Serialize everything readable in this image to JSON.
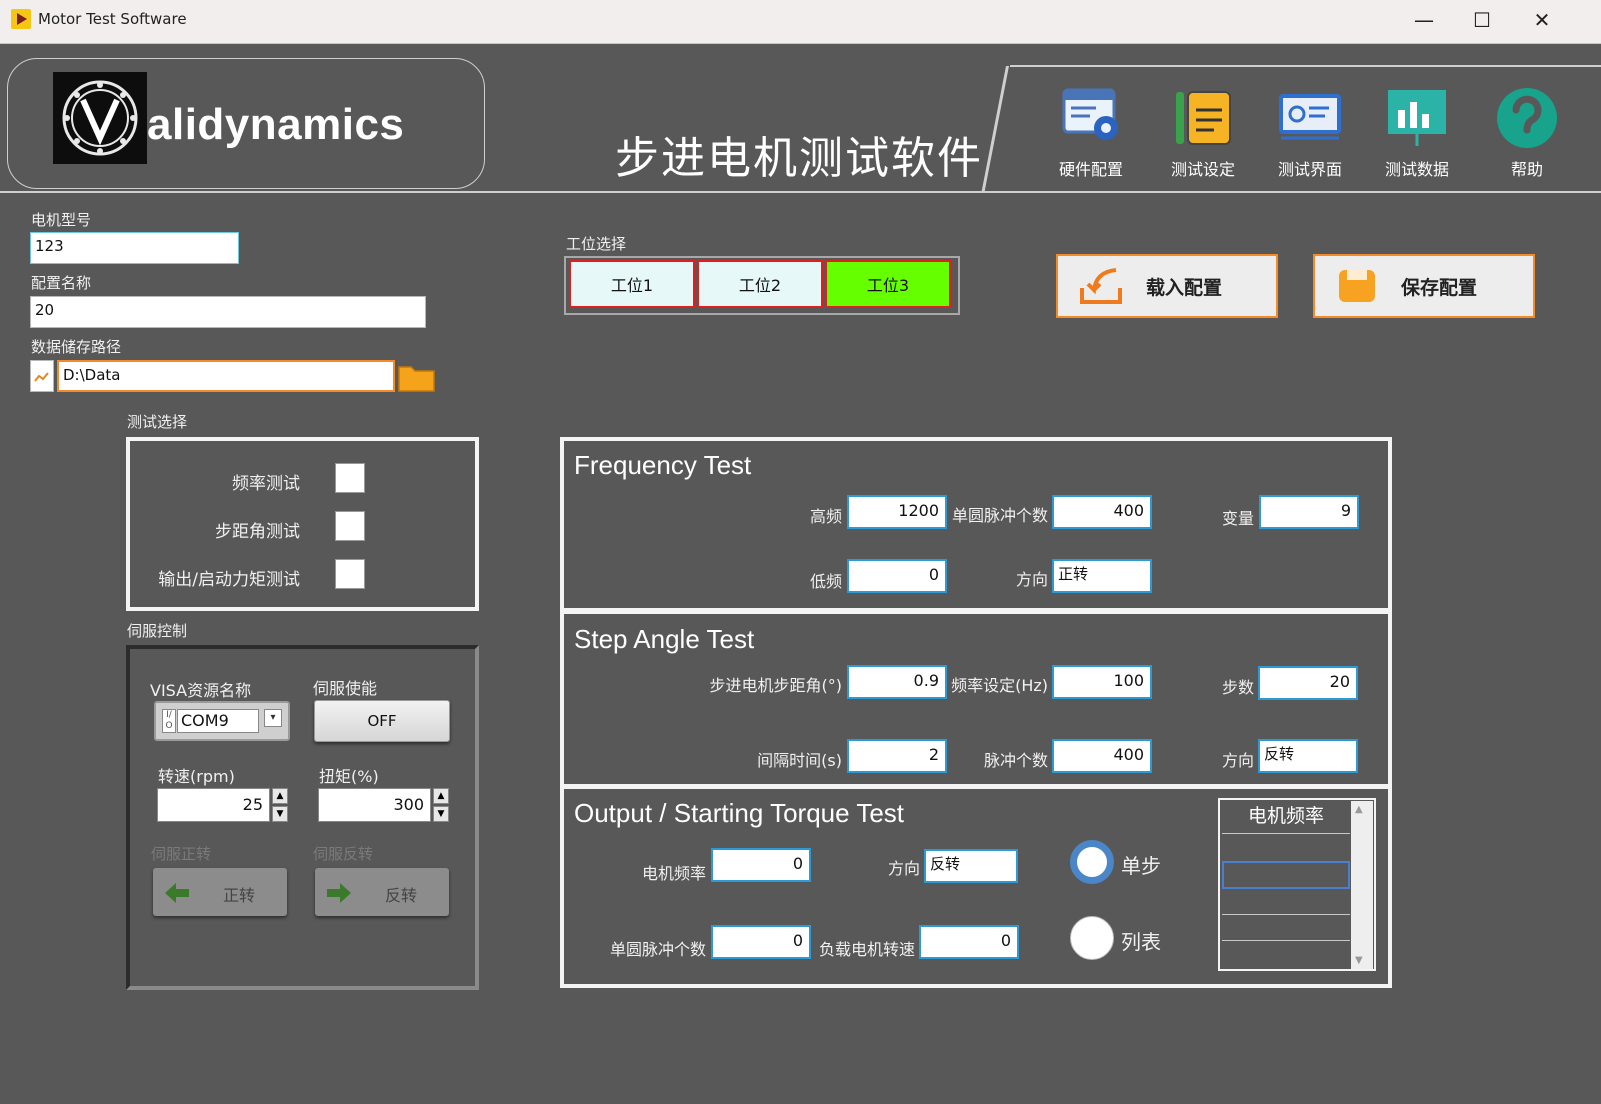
{
  "window": {
    "title": "Motor Test Software",
    "minimize": "—",
    "maximize": "☐",
    "close": "✕"
  },
  "header": {
    "logo_text": "alidynamics",
    "app_heading": "步进电机测试软件"
  },
  "nav": [
    {
      "label": "硬件配置",
      "icon": "hardware-config-icon"
    },
    {
      "label": "测试设定",
      "icon": "test-settings-icon"
    },
    {
      "label": "测试界面",
      "icon": "test-interface-icon"
    },
    {
      "label": "测试数据",
      "icon": "test-data-icon"
    },
    {
      "label": "帮助",
      "icon": "help-icon"
    }
  ],
  "config": {
    "motor_model_label": "电机型号",
    "motor_model_value": "123",
    "config_name_label": "配置名称",
    "config_name_value": "20",
    "data_path_label": "数据储存路径",
    "data_path_value": "D:\\Data"
  },
  "stations": {
    "label": "工位选择",
    "items": [
      "工位1",
      "工位2",
      "工位3"
    ],
    "active_index": 2
  },
  "actions": {
    "load_config": "载入配置",
    "save_config": "保存配置"
  },
  "test_select": {
    "label": "测试选择",
    "items": [
      {
        "label": "频率测试",
        "checked": false
      },
      {
        "label": "步距角测试",
        "checked": false
      },
      {
        "label": "输出/启动力矩测试",
        "checked": false
      }
    ]
  },
  "servo": {
    "label": "伺服控制",
    "visa_label": "VISA资源名称",
    "visa_value": "COM9",
    "enable_label": "伺服使能",
    "enable_value": "OFF",
    "speed_label": "转速(rpm)",
    "speed_value": "25",
    "torque_label": "扭矩(%)",
    "torque_value": "300",
    "forward_label": "伺服正转",
    "forward_button": "正转",
    "reverse_label": "伺服反转",
    "reverse_button": "反转"
  },
  "frequency_test": {
    "title": "Frequency Test",
    "high_freq_label": "高频",
    "high_freq_value": "1200",
    "pulses_per_rev_label": "单圆脉冲个数",
    "pulses_per_rev_value": "400",
    "variable_label": "变量",
    "variable_value": "9",
    "low_freq_label": "低频",
    "low_freq_value": "0",
    "direction_label": "方向",
    "direction_value": "正转"
  },
  "step_angle_test": {
    "title": "Step Angle Test",
    "step_angle_label": "步进电机步距角(°)",
    "step_angle_value": "0.9",
    "freq_set_label": "频率设定(Hz)",
    "freq_set_value": "100",
    "steps_label": "步数",
    "steps_value": "20",
    "interval_label": "间隔时间(s)",
    "interval_value": "2",
    "pulse_count_label": "脉冲个数",
    "pulse_count_value": "400",
    "direction_label": "方向",
    "direction_value": "反转"
  },
  "torque_test": {
    "title": "Output / Starting Torque Test",
    "motor_freq_label": "电机频率",
    "motor_freq_value": "0",
    "direction_label": "方向",
    "direction_value": "反转",
    "pulses_per_rev_label": "单圆脉冲个数",
    "pulses_per_rev_value": "0",
    "load_speed_label": "负载电机转速",
    "load_speed_value": "0",
    "mode_single": "单步",
    "mode_list": "列表",
    "mode_selected": "单步",
    "list_header": "电机频率"
  },
  "colors": {
    "background": "#585858",
    "active_station": "#66ff00",
    "station_bg": "#e6f8f8",
    "station_border": "#e0201c",
    "accent_orange": "#f58a28",
    "field_border": "#2b9ad6"
  }
}
